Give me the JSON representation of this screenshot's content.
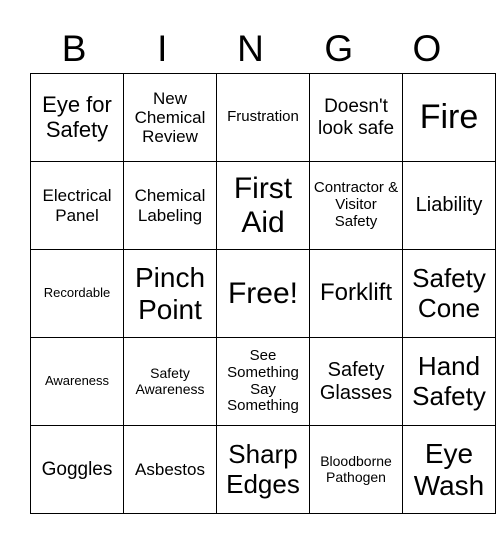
{
  "header": [
    "B",
    "I",
    "N",
    "G",
    "O"
  ],
  "cells": [
    [
      "Eye for Safety",
      "New Chemical Review",
      "Frustration",
      "Doesn't look safe",
      "Fire"
    ],
    [
      "Electrical Panel",
      "Chemical Labeling",
      "First Aid",
      "Contractor & Visitor Safety",
      "Liability"
    ],
    [
      "Recordable",
      "Pinch Point",
      "Free!",
      "Forklift",
      "Safety Cone"
    ],
    [
      "Awareness",
      "Safety Awareness",
      "See Something Say Something",
      "Safety Glasses",
      "Hand Safety"
    ],
    [
      "Goggles",
      "Asbestos",
      "Sharp Edges",
      "Bloodborne Pathogen",
      "Eye Wash"
    ]
  ]
}
